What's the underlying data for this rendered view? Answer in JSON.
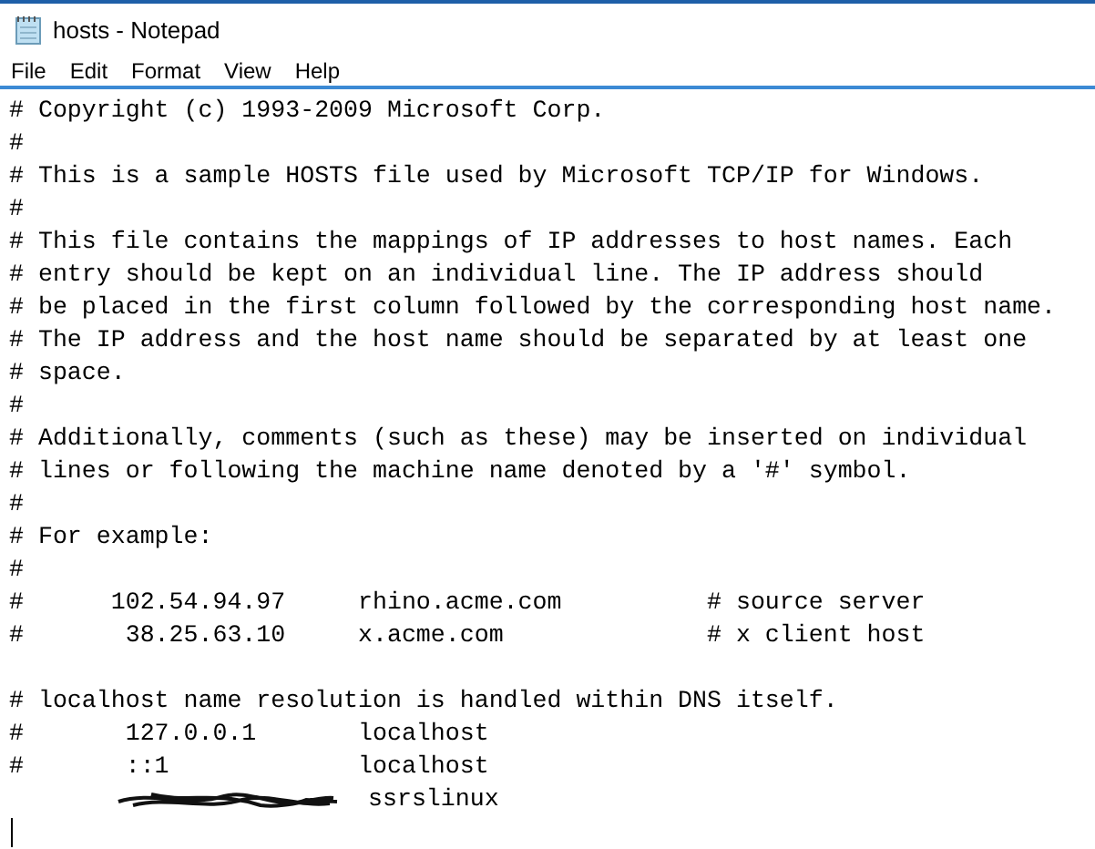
{
  "window": {
    "title": "hosts - Notepad"
  },
  "menu": [
    "File",
    "Edit",
    "Format",
    "View",
    "Help"
  ],
  "lines": [
    {
      "kind": "text",
      "text": "# Copyright (c) 1993-2009 Microsoft Corp."
    },
    {
      "kind": "text",
      "text": "#"
    },
    {
      "kind": "text",
      "text": "# This is a sample HOSTS file used by Microsoft TCP/IP for Windows."
    },
    {
      "kind": "text",
      "text": "#"
    },
    {
      "kind": "text",
      "text": "# This file contains the mappings of IP addresses to host names. Each"
    },
    {
      "kind": "text",
      "text": "# entry should be kept on an individual line. The IP address should"
    },
    {
      "kind": "text",
      "text": "# be placed in the first column followed by the corresponding host name."
    },
    {
      "kind": "text",
      "text": "# The IP address and the host name should be separated by at least one"
    },
    {
      "kind": "text",
      "text": "# space."
    },
    {
      "kind": "text",
      "text": "#"
    },
    {
      "kind": "text",
      "text": "# Additionally, comments (such as these) may be inserted on individual"
    },
    {
      "kind": "text",
      "text": "# lines or following the machine name denoted by a '#' symbol."
    },
    {
      "kind": "text",
      "text": "#"
    },
    {
      "kind": "text",
      "text": "# For example:"
    },
    {
      "kind": "text",
      "text": "#"
    },
    {
      "kind": "text",
      "text": "#      102.54.94.97     rhino.acme.com          # source server"
    },
    {
      "kind": "text",
      "text": "#       38.25.63.10     x.acme.com              # x client host"
    },
    {
      "kind": "blank"
    },
    {
      "kind": "text",
      "text": "# localhost name resolution is handled within DNS itself."
    },
    {
      "kind": "text",
      "text": "#       127.0.0.1       localhost"
    },
    {
      "kind": "text",
      "text": "#       ::1             localhost"
    },
    {
      "kind": "redacted",
      "text": "ssrslinux"
    },
    {
      "kind": "caret"
    }
  ]
}
